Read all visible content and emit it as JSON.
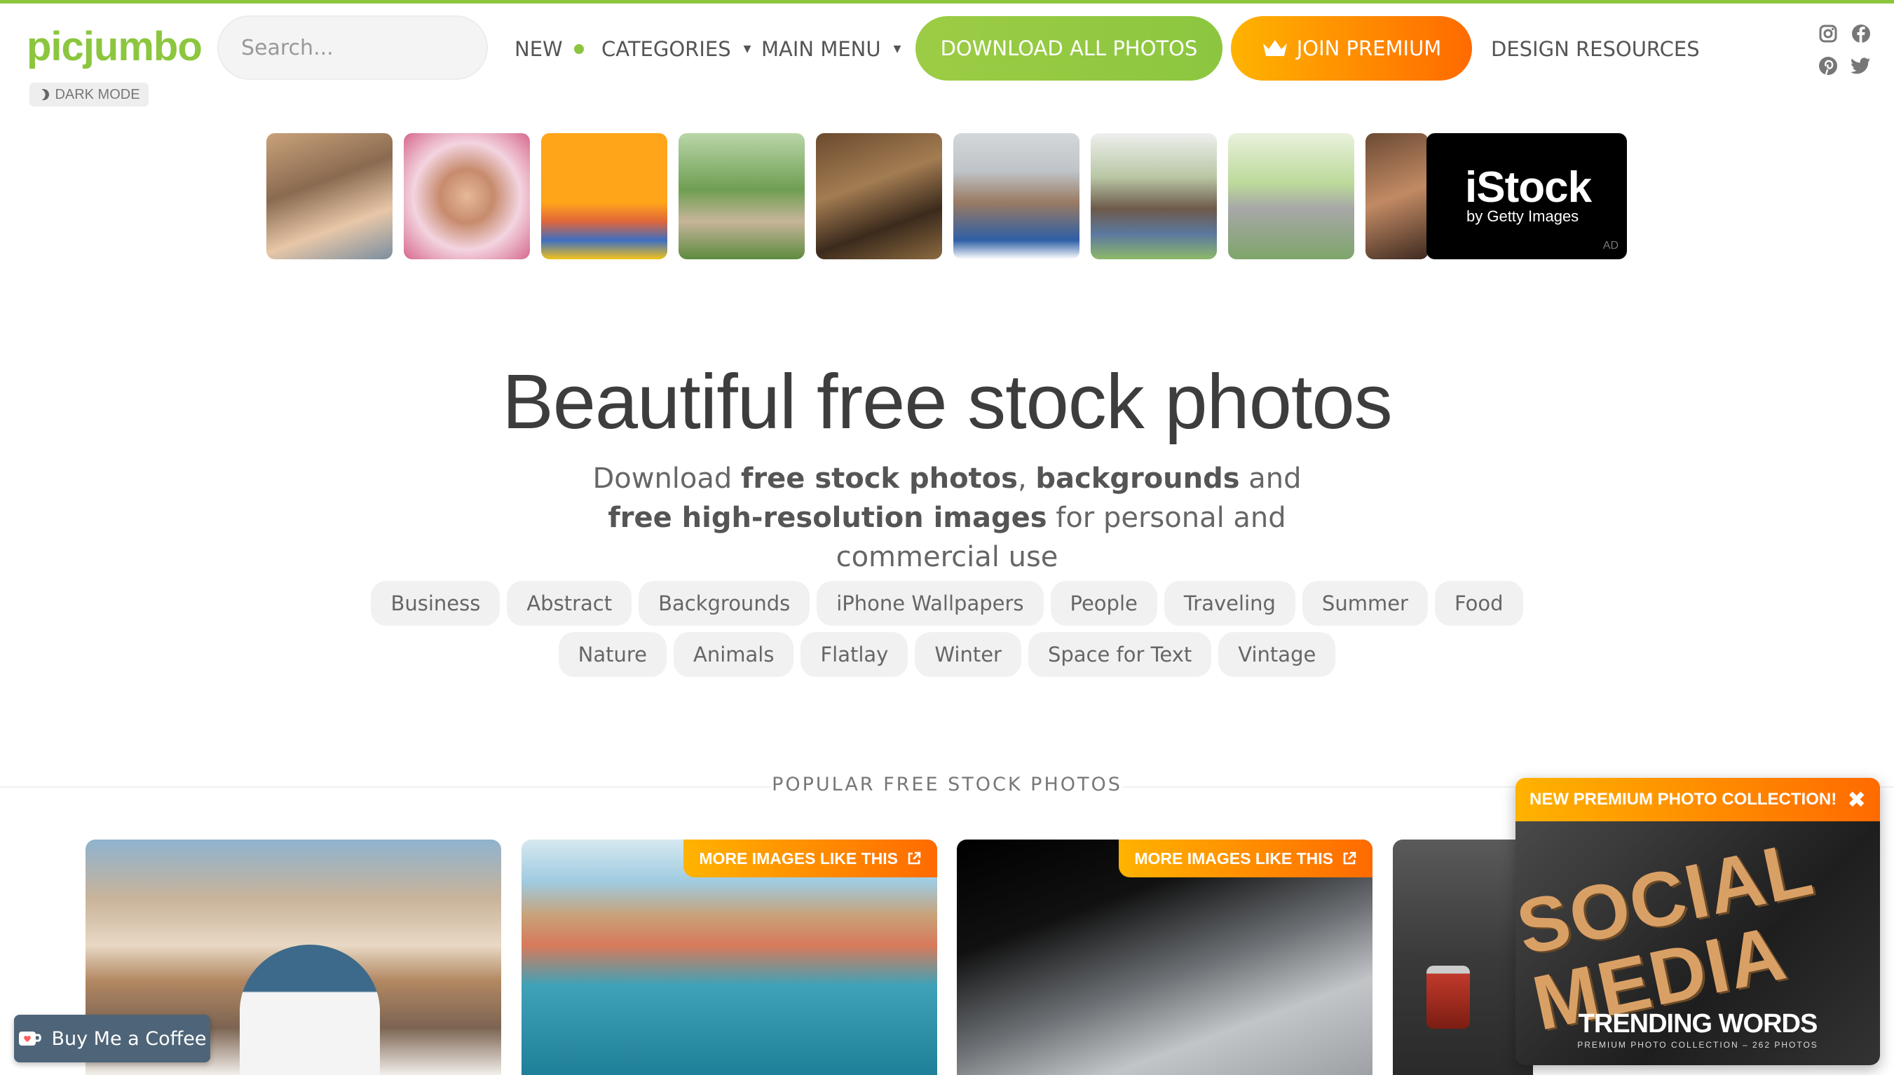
{
  "brand": {
    "logo": "picjumbo",
    "dark_mode_label": "DARK MODE"
  },
  "search": {
    "placeholder": "Search..."
  },
  "nav": {
    "new": "NEW",
    "categories": "CATEGORIES",
    "main_menu": "MAIN MENU",
    "design_resources": "DESIGN RESOURCES"
  },
  "buttons": {
    "download_all": "DOWNLOAD ALL PHOTOS",
    "join_premium": "JOIN PREMIUM"
  },
  "social_icons": [
    "instagram-icon",
    "facebook-icon",
    "pinterest-icon",
    "twitter-icon"
  ],
  "ad": {
    "brand": "iStock",
    "sub": "by Getty Images",
    "badge": "AD"
  },
  "hero": {
    "title": "Beautiful free stock photos",
    "sub": {
      "p1": "Download ",
      "b1": "free stock photos",
      "p2": ", ",
      "b2": "backgrounds",
      "p3": " and ",
      "b3": "free high-resolution images",
      "p4": " for personal and commercial use"
    }
  },
  "tags": {
    "row1": [
      "Business",
      "Abstract",
      "Backgrounds",
      "iPhone Wallpapers",
      "People",
      "Traveling",
      "Summer",
      "Food"
    ],
    "row2": [
      "Nature",
      "Animals",
      "Flatlay",
      "Winter",
      "Space for Text",
      "Vintage"
    ]
  },
  "section": {
    "popular": "POPULAR FREE STOCK PHOTOS"
  },
  "cards": {
    "more_label": "MORE IMAGES LIKE THIS"
  },
  "widgets": {
    "buy_coffee": "Buy Me a Coffee",
    "promo_header": "NEW PREMIUM PHOTO COLLECTION!",
    "promo_big": "SOCIAL MEDIA",
    "promo_title": "TRENDING WORDS",
    "promo_sub": "PREMIUM PHOTO COLLECTION – 262 PHOTOS"
  },
  "colors": {
    "brand_green": "#8cc63f",
    "accent_orange": "#ff8a00"
  }
}
